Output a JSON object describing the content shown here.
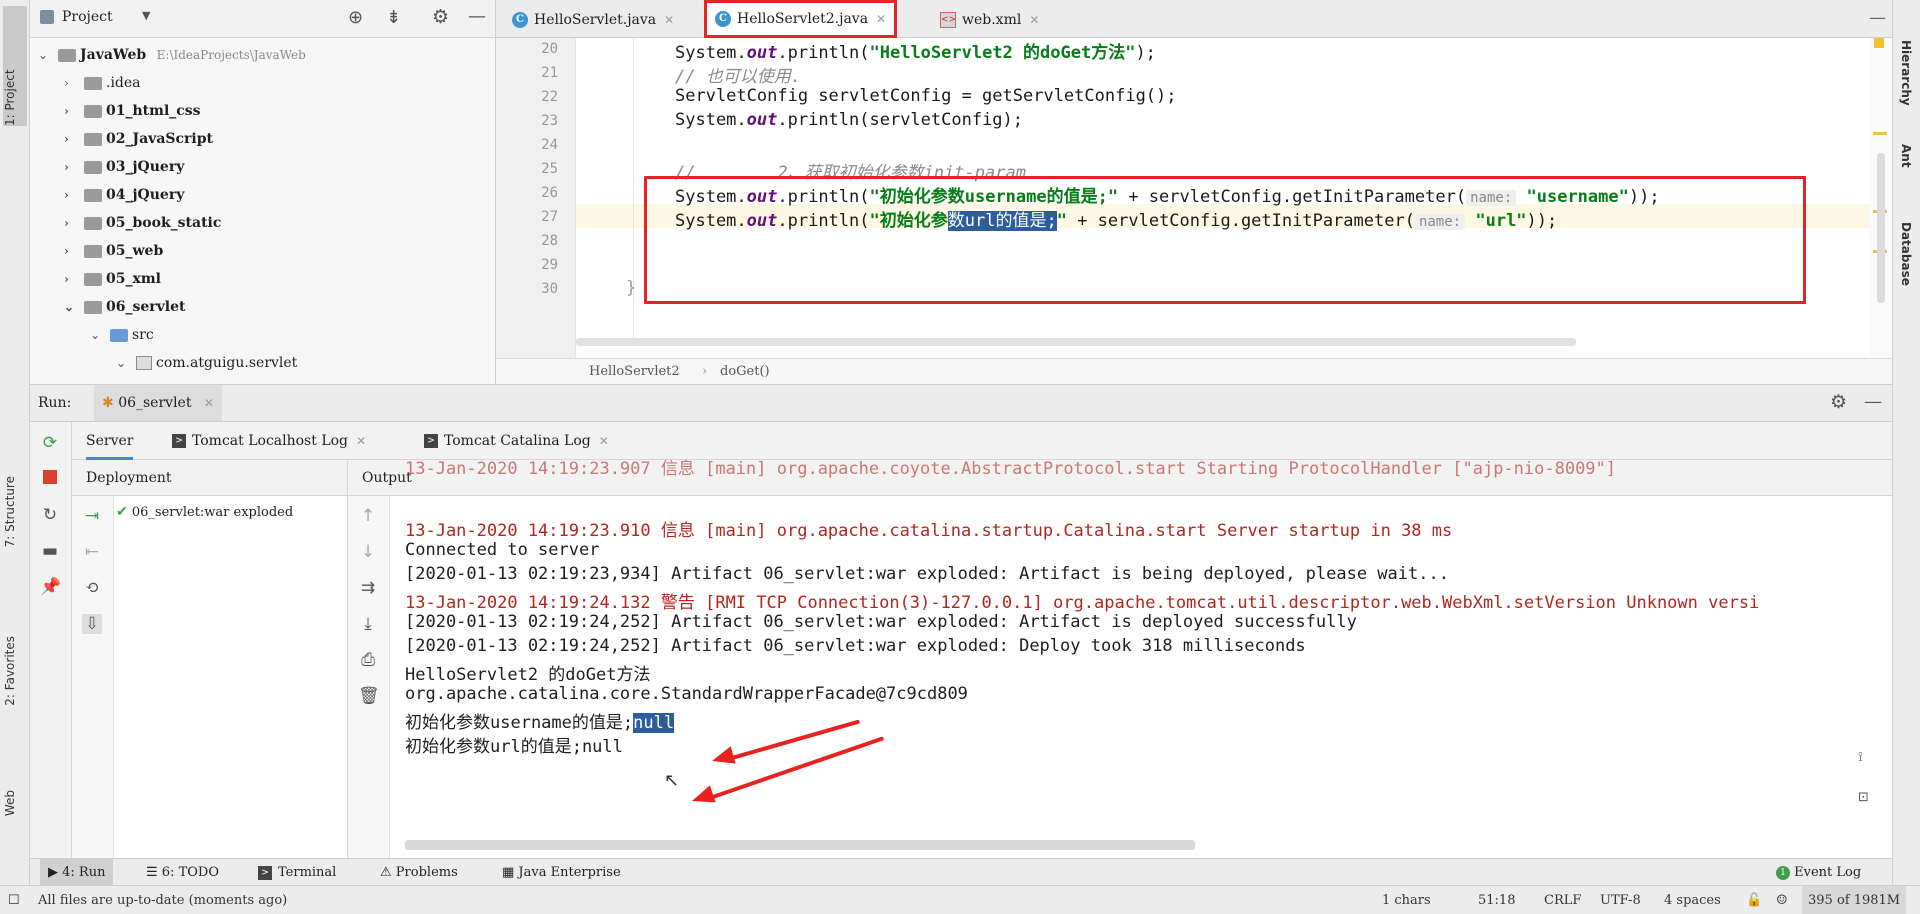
{
  "left_strip": {
    "project_tab": "1: Project",
    "structure_tab": "7: Structure",
    "favorites_tab": "2: Favorites",
    "web_tab": "Web"
  },
  "right_strip": {
    "hierarchy": "Hierarchy",
    "ant": "Ant",
    "database": "Database"
  },
  "project": {
    "title": "Project",
    "root_name": "JavaWeb",
    "root_path": "E:\\IdeaProjects\\JavaWeb",
    "items": [
      ".idea",
      "01_html_css",
      "02_JavaScript",
      "03_jQuery",
      "04_jQuery",
      "05_book_static",
      "05_web",
      "05_xml",
      "06_servlet",
      "src",
      "com.atguigu.servlet"
    ]
  },
  "editor": {
    "tabs": [
      "HelloServlet.java",
      "HelloServlet2.java",
      "web.xml"
    ],
    "active_tab": "HelloServlet2.java",
    "line_numbers": [
      "20",
      "21",
      "22",
      "23",
      "24",
      "25",
      "26",
      "27",
      "28",
      "29",
      "30"
    ],
    "code": {
      "l20_a": "System.",
      "l20_b": "out",
      "l20_c": ".println(",
      "l20_d": "\"HelloServlet2 的doGet方法\"",
      "l20_e": ");",
      "l21": "// 也可以使用.",
      "l22": "ServletConfig servletConfig = getServletConfig();",
      "l23_a": "System.",
      "l23_b": "out",
      "l23_c": ".println(servletConfig);",
      "l25": "//        2、获取初始化参数init-param",
      "l26_a": "System.",
      "l26_b": "out",
      "l26_c": ".println(",
      "l26_d": "\"初始化参数username的值是;\"",
      "l26_e": " + servletConfig.getInitParameter(",
      "l26_hint": "name:",
      "l26_f": "\"username\"",
      "l26_g": "));",
      "l27_a": "System.",
      "l27_b": "out",
      "l27_c": ".println(",
      "l27_d1": "\"初始化参",
      "l27_sel": "数url的值是;",
      "l27_d2": "\"",
      "l27_e": " + servletConfig.getInitParameter(",
      "l27_hint": "name:",
      "l27_f": "\"url\"",
      "l27_g": "));",
      "l30": "}"
    },
    "breadcrumb": [
      "HelloServlet2",
      "doGet()"
    ]
  },
  "run": {
    "label": "Run:",
    "config": "06_servlet",
    "server_tabs": [
      "Server",
      "Tomcat Localhost Log",
      "Tomcat Catalina Log"
    ],
    "deployment_header": "Deployment",
    "output_header": "Output",
    "artifact": "06_servlet:war exploded",
    "log_lines": [
      "13-Jan-2020 14:19:23.910 信息 [main] org.apache.catalina.startup.Catalina.start Server startup in 38 ms",
      "Connected to server",
      "[2020-01-13 02:19:23,934] Artifact 06_servlet:war exploded: Artifact is being deployed, please wait...",
      "13-Jan-2020 14:19:24.132 警告 [RMI TCP Connection(3)-127.0.0.1] org.apache.tomcat.util.descriptor.web.WebXml.setVersion Unknown versi",
      "[2020-01-13 02:19:24,252] Artifact 06_servlet:war exploded: Artifact is deployed successfully",
      "[2020-01-13 02:19:24,252] Artifact 06_servlet:war exploded: Deploy took 318 milliseconds",
      "HelloServlet2 的doGet方法",
      "org.apache.catalina.core.StandardWrapperFacade@7c9cd809",
      "初始化参数username的值是;",
      "初始化参数url的值是;null"
    ],
    "null_selected": "null"
  },
  "bottom_tools": [
    "4: Run",
    "6: TODO",
    "Terminal",
    "Problems",
    "Java Enterprise",
    "Event Log"
  ],
  "status": {
    "message": "All files are up-to-date (moments ago)",
    "chars": "1 chars",
    "position": "51:18",
    "line_sep": "CRLF",
    "encoding": "UTF-8",
    "indent": "4 spaces",
    "memory": "395 of 1981M"
  },
  "colors": {
    "accent_red": "#e02626",
    "selection": "#2e5d9e",
    "string_green": "#067d17",
    "log_red": "#b3261e"
  }
}
